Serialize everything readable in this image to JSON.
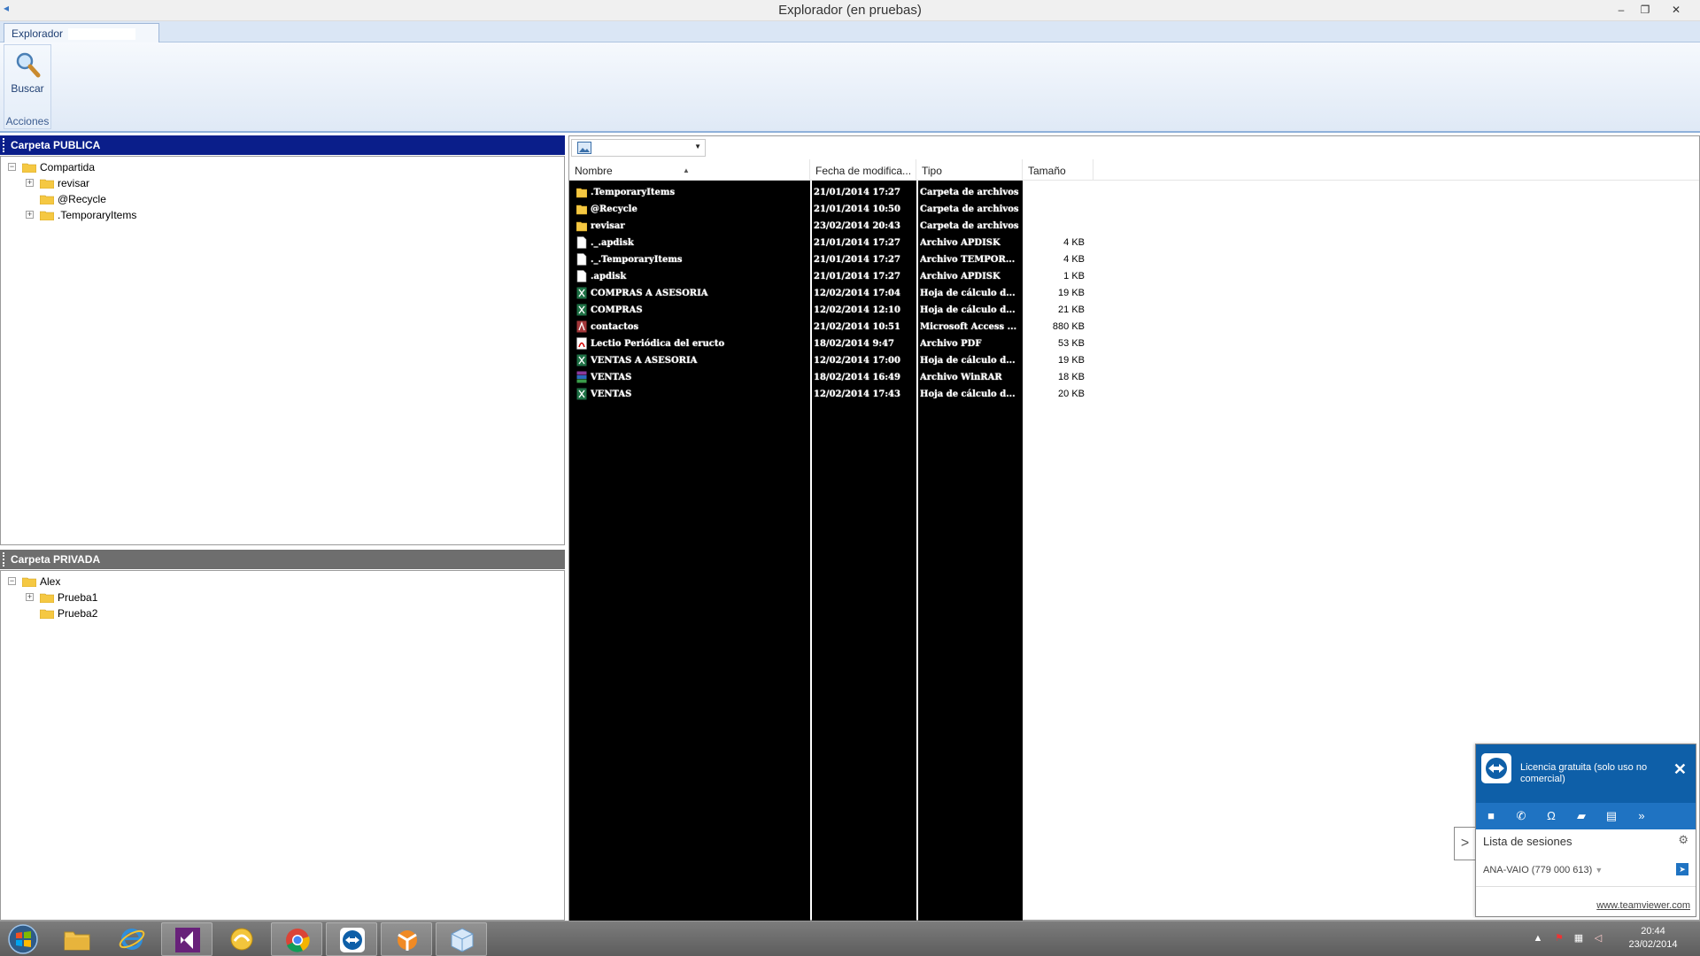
{
  "window": {
    "title": "Explorador (en pruebas)",
    "minimize": "–",
    "maximize": "❐",
    "close": "✕"
  },
  "ribbon": {
    "tab_label": "Explorador",
    "search_button": "Buscar",
    "group_label": "Acciones"
  },
  "public_pane": {
    "title": "Carpeta PUBLICA",
    "tree": [
      {
        "label": "Compartida",
        "expander": "−"
      },
      {
        "label": "revisar",
        "expander": "+"
      },
      {
        "label": "@Recycle",
        "expander": ""
      },
      {
        "label": ".TemporaryItems",
        "expander": "+"
      }
    ]
  },
  "private_pane": {
    "title": "Carpeta PRIVADA",
    "tree": [
      {
        "label": "Alex",
        "expander": "−"
      },
      {
        "label": "Prueba1",
        "expander": "+"
      },
      {
        "label": "Prueba2",
        "expander": ""
      }
    ]
  },
  "file_list": {
    "columns": {
      "name": "Nombre",
      "date": "Fecha de modifica...",
      "type": "Tipo",
      "size": "Tamaño"
    },
    "rows": [
      {
        "icon": "folder-icon",
        "name": ".TemporaryItems",
        "date": "21/01/2014 17:27",
        "type": "Carpeta de archivos",
        "size": ""
      },
      {
        "icon": "folder-icon",
        "name": "@Recycle",
        "date": "21/01/2014 10:50",
        "type": "Carpeta de archivos",
        "size": ""
      },
      {
        "icon": "folder-icon",
        "name": "revisar",
        "date": "23/02/2014 20:43",
        "type": "Carpeta de archivos",
        "size": ""
      },
      {
        "icon": "file-icon",
        "name": "._.apdisk",
        "date": "21/01/2014 17:27",
        "type": "Archivo APDISK",
        "size": "4 KB"
      },
      {
        "icon": "file-icon",
        "name": "._.TemporaryItems",
        "date": "21/01/2014 17:27",
        "type": "Archivo TEMPOR...",
        "size": "4 KB"
      },
      {
        "icon": "file-icon",
        "name": ".apdisk",
        "date": "21/01/2014 17:27",
        "type": "Archivo APDISK",
        "size": "1 KB"
      },
      {
        "icon": "excel-icon",
        "name": "COMPRAS A ASESORIA",
        "date": "12/02/2014 17:04",
        "type": "Hoja de cálculo d...",
        "size": "19 KB"
      },
      {
        "icon": "excel-icon",
        "name": "COMPRAS",
        "date": "12/02/2014 12:10",
        "type": "Hoja de cálculo d...",
        "size": "21 KB"
      },
      {
        "icon": "access-icon",
        "name": "contactos",
        "date": "21/02/2014 10:51",
        "type": "Microsoft Access ...",
        "size": "880 KB"
      },
      {
        "icon": "pdf-icon",
        "name": "Lectio Periódica del eructo",
        "date": "18/02/2014 9:47",
        "type": "Archivo PDF",
        "size": "53 KB"
      },
      {
        "icon": "excel-icon",
        "name": "VENTAS A ASESORIA",
        "date": "12/02/2014 17:00",
        "type": "Hoja de cálculo d...",
        "size": "19 KB"
      },
      {
        "icon": "winrar-icon",
        "name": "VENTAS",
        "date": "18/02/2014 16:49",
        "type": "Archivo WinRAR",
        "size": "18 KB"
      },
      {
        "icon": "excel-icon",
        "name": "VENTAS",
        "date": "12/02/2014 17:43",
        "type": "Hoja de cálculo d...",
        "size": "20 KB"
      }
    ]
  },
  "teamviewer": {
    "license": "Licencia gratuita (solo uso no comercial)",
    "sessions_label": "Lista de sesiones",
    "computer": "ANA-VAIO (779 000 613)",
    "link": "www.teamviewer.com",
    "close": "✕",
    "expand": ">"
  },
  "taskbar": {
    "apps": [
      "file-explorer-icon",
      "internet-explorer-icon",
      "visual-studio-icon",
      "app-icon-yellow",
      "chrome-icon",
      "teamviewer-icon",
      "avast-icon",
      "explorer-app-icon"
    ],
    "clock_time": "20:44",
    "clock_date": "23/02/2014"
  },
  "colors": {
    "public_header": "#0a1e8a",
    "private_header": "#6e6e6e",
    "teamviewer_blue": "#0e5fa8"
  }
}
